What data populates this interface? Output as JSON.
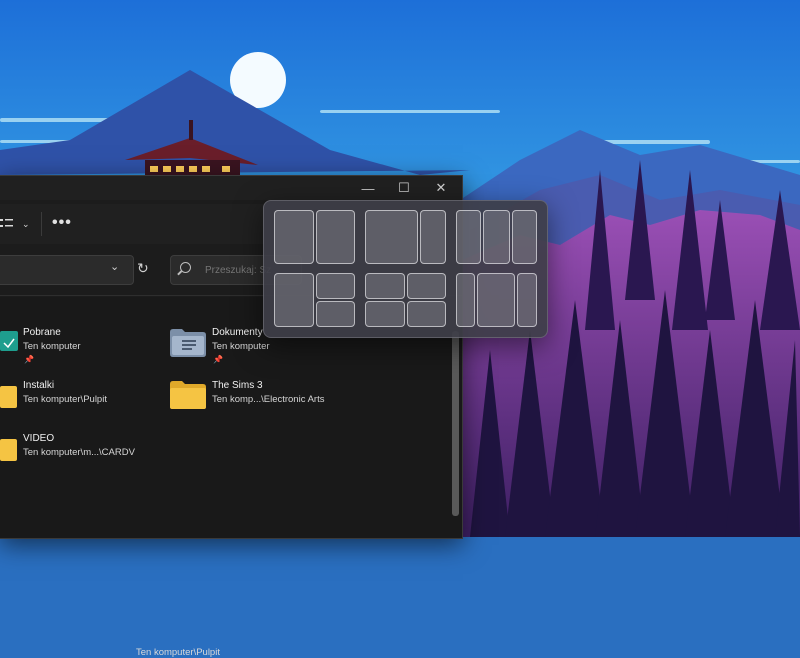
{
  "window": {
    "controls": {
      "minimize": "—",
      "maximize": "☐",
      "close": "✕"
    }
  },
  "toolbar": {
    "view_icon": "view-options-icon",
    "more_label": "•••"
  },
  "address": {
    "dropdown_icon": "chevron-down-icon",
    "refresh_icon": "refresh-icon"
  },
  "search": {
    "placeholder": "Przeszukaj: Sz"
  },
  "items": [
    {
      "name": "Pobrane",
      "path": "Ten komputer",
      "pinned": true,
      "icon": "downloads-folder-icon"
    },
    {
      "name": "Dokumenty",
      "path": "Ten komputer",
      "pinned": true,
      "icon": "documents-folder-icon"
    },
    {
      "name": "Instalki",
      "path": "Ten komputer\\Pulpit",
      "pinned": false,
      "icon": "folder-icon"
    },
    {
      "name": "The Sims 3",
      "path": "Ten komp...\\Electronic Arts",
      "pinned": false,
      "icon": "folder-icon"
    },
    {
      "name": "VIDEO",
      "path": "Ten komputer\\m...\\CARDV",
      "pinned": false,
      "icon": "folder-icon"
    }
  ],
  "pin_glyph": "📌",
  "status_bar": {
    "location": "Ten komputer\\Pulpit"
  },
  "snap_layouts": {
    "layouts": [
      "half-half",
      "two-thirds-one-third",
      "thirds",
      "half-quarters",
      "quarters",
      "quarter-half-quarter"
    ]
  },
  "colors": {
    "sky_top": "#1d6fd8",
    "sky_bottom": "#4fc3e8",
    "window_bg": "#1c1c1c",
    "forest_purple": "#7a3f9e",
    "folder_yellow": "#f5c443"
  }
}
